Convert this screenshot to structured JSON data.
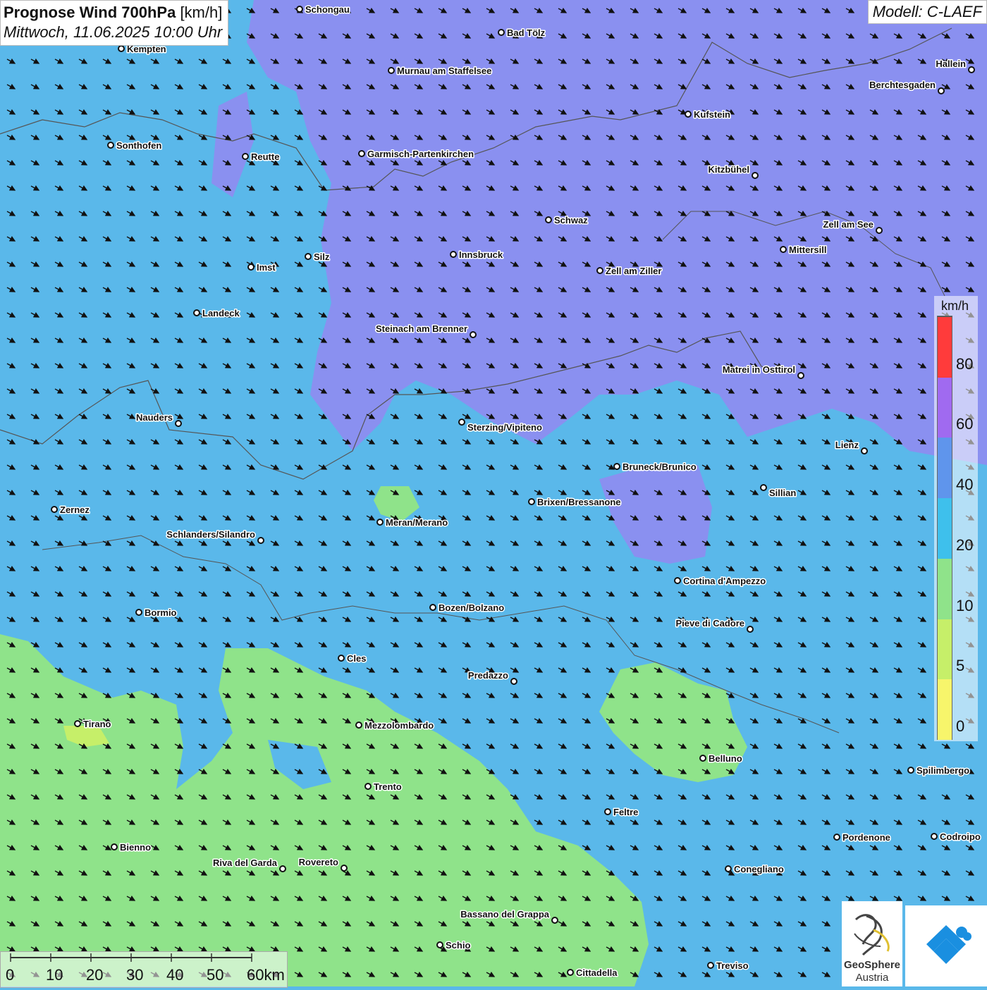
{
  "header": {
    "title_bold": "Prognose Wind 700hPa",
    "title_unit": "[km/h]",
    "datetime": "Mittwoch, 11.06.2025 10:00 Uhr",
    "model": "Modell: C-LAEF"
  },
  "legend": {
    "unit": "km/h",
    "ticks": [
      "0",
      "5",
      "10",
      "20",
      "40",
      "60",
      "80"
    ],
    "colors": [
      "#f7f56b",
      "#c6ef69",
      "#8fe38a",
      "#3ec0ec",
      "#5f95ec",
      "#a06af0",
      "#ff3b3b"
    ]
  },
  "scale_bar": {
    "labels": [
      "0",
      "10",
      "20",
      "30",
      "40",
      "50",
      "60km"
    ]
  },
  "logos": {
    "geosphere_line1": "GeoSphere",
    "geosphere_line2": "Austria",
    "geosphere_icon": "geosphere-logo-icon",
    "app_icon": "wetter-app-logo-icon"
  },
  "map_colors": {
    "strong_wind_purple": "#8f8cf2",
    "mid_wind_blue": "#5ab8ea",
    "light_wind_green": "#8fe38a"
  },
  "cities": [
    {
      "name": "Schongau"
    },
    {
      "name": "Bad Tölz"
    },
    {
      "name": "Kempten"
    },
    {
      "name": "Hallein"
    },
    {
      "name": "Murnau am Staffelsee"
    },
    {
      "name": "Berchtesgaden"
    },
    {
      "name": "Kufstein"
    },
    {
      "name": "Sonthofen"
    },
    {
      "name": "Reutte"
    },
    {
      "name": "Garmisch-Partenkirchen"
    },
    {
      "name": "Kitzbühel"
    },
    {
      "name": "Schwaz"
    },
    {
      "name": "Zell am See"
    },
    {
      "name": "Innsbruck"
    },
    {
      "name": "Mittersill"
    },
    {
      "name": "Silz"
    },
    {
      "name": "Imst"
    },
    {
      "name": "Zell am Ziller"
    },
    {
      "name": "Landeck"
    },
    {
      "name": "Steinach am Brenner"
    },
    {
      "name": "Matrei in Osttirol"
    },
    {
      "name": "Nauders"
    },
    {
      "name": "Sterzing/Vipiteno"
    },
    {
      "name": "Lienz"
    },
    {
      "name": "Bruneck/Brunico"
    },
    {
      "name": "Sillian"
    },
    {
      "name": "Brixen/Bressanone"
    },
    {
      "name": "Zernez"
    },
    {
      "name": "Meran/Merano"
    },
    {
      "name": "Schlanders/Silandro"
    },
    {
      "name": "Cortina d'Ampezzo"
    },
    {
      "name": "Bozen/Bolzano"
    },
    {
      "name": "Bormio"
    },
    {
      "name": "Pieve di Cadore"
    },
    {
      "name": "Cles"
    },
    {
      "name": "Predazzo"
    },
    {
      "name": "Tirano"
    },
    {
      "name": "Mezzolombardo"
    },
    {
      "name": "Belluno"
    },
    {
      "name": "Spilimbergo"
    },
    {
      "name": "Trento"
    },
    {
      "name": "Feltre"
    },
    {
      "name": "Pordenone"
    },
    {
      "name": "Codroipo"
    },
    {
      "name": "Bienno"
    },
    {
      "name": "Riva del Garda"
    },
    {
      "name": "Rovereto"
    },
    {
      "name": "Conegliano"
    },
    {
      "name": "Bassano del Grappa"
    },
    {
      "name": "Schio"
    },
    {
      "name": "Treviso"
    },
    {
      "name": "Cittadella"
    }
  ]
}
